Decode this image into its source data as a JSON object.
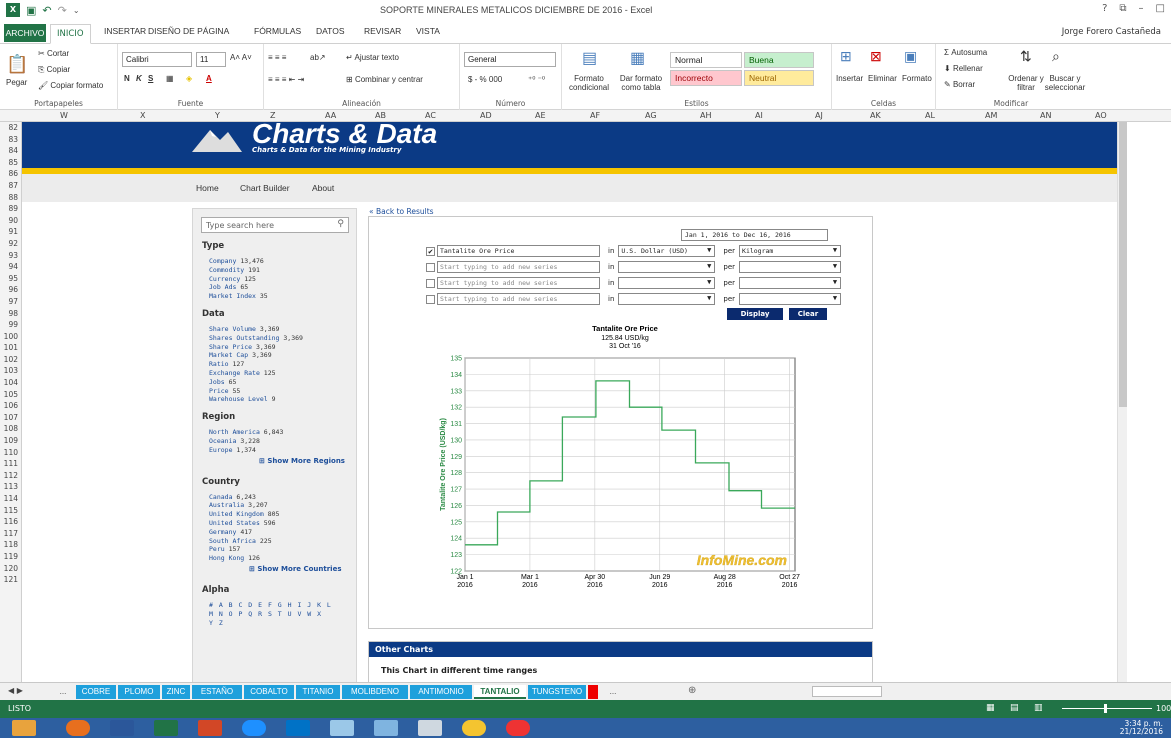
{
  "window": {
    "title": "SOPORTE MINERALES METALICOS DICIEMBRE DE 2016 - Excel",
    "user": "Jorge Forero Castañeda",
    "controls": [
      "?",
      "⧉",
      "–",
      "□"
    ]
  },
  "ribbon_tabs": [
    "ARCHIVO",
    "INICIO",
    "INSERTAR",
    "DISEÑO DE PÁGINA",
    "FÓRMULAS",
    "DATOS",
    "REVISAR",
    "VISTA"
  ],
  "ribbon": {
    "clipboard": {
      "paste": "Pegar",
      "cut": "Cortar",
      "copy": "Copiar",
      "format_painter": "Copiar formato",
      "label": "Portapapeles"
    },
    "font": {
      "name": "Calibri",
      "size": "11",
      "label": "Fuente"
    },
    "alignment": {
      "wrap": "Ajustar texto",
      "merge": "Combinar y centrar",
      "label": "Alineación"
    },
    "number": {
      "format": "General",
      "label": "Número",
      "symbols": "$ - % 000"
    },
    "styles": {
      "conditional": "Formato condicional",
      "as_table": "Dar formato como tabla",
      "normal": "Normal",
      "good": "Buena",
      "bad": "Incorrecto",
      "neutral": "Neutral",
      "label": "Estilos"
    },
    "cells": {
      "insert": "Insertar",
      "delete": "Eliminar",
      "format": "Formato",
      "label": "Celdas"
    },
    "editing": {
      "autosum": "Autosuma",
      "fill": "Rellenar",
      "clear": "Borrar",
      "sort": "Ordenar y filtrar",
      "find": "Buscar y seleccionar",
      "label": "Modificar"
    }
  },
  "columns": [
    "W",
    "X",
    "Y",
    "Z",
    "AA",
    "AB",
    "AC",
    "AD",
    "AE",
    "AF",
    "AG",
    "AH",
    "AI",
    "AJ",
    "AK",
    "AL",
    "AM",
    "AN",
    "AO"
  ],
  "rows": [
    "82",
    "83",
    "84",
    "85",
    "86",
    "87",
    "88",
    "89",
    "90",
    "91",
    "92",
    "93",
    "94",
    "95",
    "96",
    "97",
    "98",
    "99",
    "100",
    "101",
    "102",
    "103",
    "104",
    "105",
    "106",
    "107",
    "108",
    "109",
    "110",
    "111",
    "112",
    "113",
    "114",
    "115",
    "116",
    "117",
    "118",
    "119",
    "120",
    "121"
  ],
  "site": {
    "logo": "Charts & Data",
    "tagline": "Charts & Data for the Mining Industry",
    "nav": [
      "Home",
      "Chart Builder",
      "About"
    ],
    "back": "« Back to Results",
    "search_placeholder": "Type search here",
    "type_title": "Type",
    "type_items": [
      [
        "Company",
        "13,476"
      ],
      [
        "Commodity",
        "191"
      ],
      [
        "Currency",
        "125"
      ],
      [
        "Job Ads",
        "65"
      ],
      [
        "Market Index",
        "35"
      ]
    ],
    "data_title": "Data",
    "data_items": [
      [
        "Share Volume",
        "3,369"
      ],
      [
        "Shares Outstanding",
        "3,369"
      ],
      [
        "Share Price",
        "3,369"
      ],
      [
        "Market Cap",
        "3,369"
      ],
      [
        "Ratio",
        "127"
      ],
      [
        "Exchange Rate",
        "125"
      ],
      [
        "Jobs",
        "65"
      ],
      [
        "Price",
        "55"
      ],
      [
        "Warehouse Level",
        "9"
      ]
    ],
    "region_title": "Region",
    "region_items": [
      [
        "North America",
        "6,843"
      ],
      [
        "Oceania",
        "3,228"
      ],
      [
        "Europe",
        "1,374"
      ]
    ],
    "show_more_regions": "Show More Regions",
    "country_title": "Country",
    "country_items": [
      [
        "Canada",
        "6,243"
      ],
      [
        "Australia",
        "3,207"
      ],
      [
        "United Kingdom",
        "805"
      ],
      [
        "United States",
        "596"
      ],
      [
        "Germany",
        "417"
      ],
      [
        "South Africa",
        "225"
      ],
      [
        "Peru",
        "157"
      ],
      [
        "Hong Kong",
        "126"
      ]
    ],
    "show_more_countries": "Show More Countries",
    "alpha_title": "Alpha",
    "alpha_rows": [
      "# A B C D E F G H I J K L",
      "M N O P Q R S T U V W X",
      "Y Z"
    ],
    "date_range": "Jan 1, 2016 to Dec 16, 2016",
    "series": [
      {
        "checked": true,
        "name": "Tantalite Ore Price",
        "unit": "U.S. Dollar (USD)",
        "per": "Kilogram"
      },
      {
        "checked": false,
        "name": "Start typing to add new series",
        "unit": "",
        "per": ""
      },
      {
        "checked": false,
        "name": "Start typing to add new series",
        "unit": "",
        "per": ""
      },
      {
        "checked": false,
        "name": "Start typing to add new series",
        "unit": "",
        "per": ""
      }
    ],
    "in_label": "in",
    "per_label": "per",
    "display_btn": "Display",
    "clear_btn": "Clear",
    "other_charts": "Other Charts",
    "other_sub": "This Chart in different time ranges",
    "watermark": "InfoMine.com"
  },
  "chart_data": {
    "type": "line",
    "title": "Tantalite Ore Price",
    "subtitle": [
      "125.84 USD/kg",
      "31 Oct '16"
    ],
    "ylabel": "Tantalite Ore Price (USD/kg)",
    "xlabel": "",
    "ylim": [
      122,
      135
    ],
    "yticks": [
      122,
      123,
      124,
      125,
      126,
      127,
      128,
      129,
      130,
      131,
      132,
      133,
      134,
      135
    ],
    "xticks": [
      {
        "day": 0,
        "label": [
          "Jan 1",
          "2016"
        ]
      },
      {
        "day": 60,
        "label": [
          "Mar 1",
          "2016"
        ]
      },
      {
        "day": 120,
        "label": [
          "Apr 30",
          "2016"
        ]
      },
      {
        "day": 180,
        "label": [
          "Jun 29",
          "2016"
        ]
      },
      {
        "day": 240,
        "label": [
          "Aug 28",
          "2016"
        ]
      },
      {
        "day": 300,
        "label": [
          "Oct 27",
          "2016"
        ]
      }
    ],
    "xlim": [
      0,
      305
    ],
    "step_points": [
      [
        0,
        123.6
      ],
      [
        30,
        123.6
      ],
      [
        30,
        125.6
      ],
      [
        60,
        125.6
      ],
      [
        60,
        127.5
      ],
      [
        90,
        127.5
      ],
      [
        90,
        131.4
      ],
      [
        121,
        131.4
      ],
      [
        121,
        133.6
      ],
      [
        152,
        133.6
      ],
      [
        152,
        132.0
      ],
      [
        182,
        132.0
      ],
      [
        182,
        130.6
      ],
      [
        213,
        130.6
      ],
      [
        213,
        128.6
      ],
      [
        244,
        128.6
      ],
      [
        244,
        126.9
      ],
      [
        274,
        126.9
      ],
      [
        274,
        125.84
      ],
      [
        305,
        125.84
      ]
    ],
    "line_color": "#3aa85a",
    "grid": true
  },
  "sheet_tabs": [
    "...",
    "COBRE",
    "PLOMO",
    "ZINC",
    "ESTAÑO",
    "COBALTO",
    "TITANIO",
    "MOLIBDENO",
    "ANTIMONIO",
    "TANTALIO",
    "TUNGSTENO",
    "..."
  ],
  "active_sheet": "TANTALIO",
  "status": {
    "mode": "LISTO",
    "zoom": "100"
  },
  "clock": {
    "time": "3:34 p. m.",
    "date": "21/12/2016"
  },
  "colors": {
    "excel_green": "#217346",
    "site_blue": "#0b3a85",
    "site_yellow": "#f5c400",
    "tab_blue": "#1ea0dc"
  }
}
